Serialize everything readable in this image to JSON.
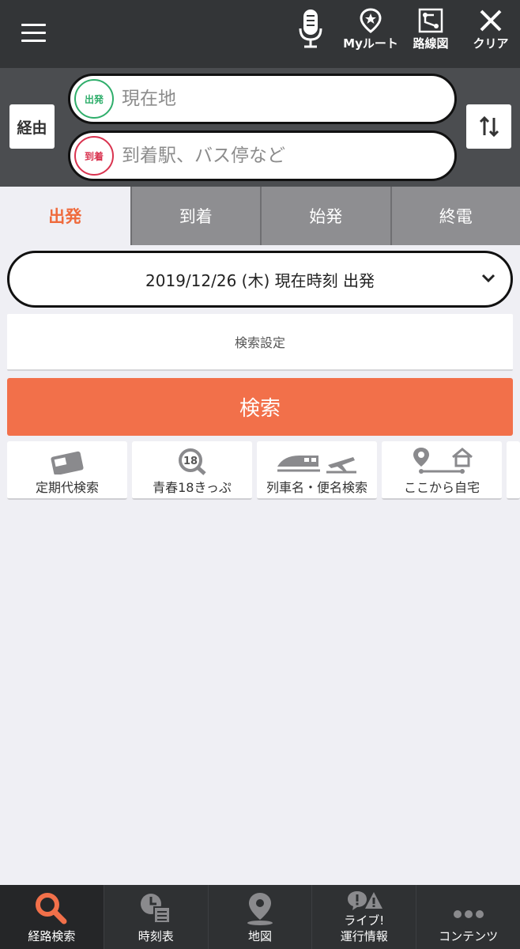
{
  "header": {
    "mic_label": "",
    "my_route_label": "Myルート",
    "route_map_label": "路線図",
    "clear_label": "クリア"
  },
  "search": {
    "via_label": "経由",
    "from_badge": "出発",
    "from_placeholder": "現在地",
    "to_badge": "到着",
    "to_placeholder": "到着駅、バス停など"
  },
  "tabs": [
    {
      "label": "出発",
      "active": true
    },
    {
      "label": "到着",
      "active": false
    },
    {
      "label": "始発",
      "active": false
    },
    {
      "label": "終電",
      "active": false
    }
  ],
  "date_selector": {
    "value": "2019/12/26 (木) 現在時刻 出発"
  },
  "settings_label": "検索設定",
  "search_button_label": "検索",
  "shortcuts": [
    {
      "label": "定期代検索",
      "icon": "commuter-pass-icon"
    },
    {
      "label": "青春18きっぷ",
      "icon": "seishun18-icon"
    },
    {
      "label": "列車名・便名検索",
      "icon": "train-plane-icon"
    },
    {
      "label": "ここから自宅",
      "icon": "route-home-icon"
    }
  ],
  "bottom_nav": [
    {
      "label": "経路検索",
      "icon": "search-icon",
      "active": true
    },
    {
      "label": "時刻表",
      "icon": "timetable-icon"
    },
    {
      "label": "地図",
      "icon": "map-pin-icon"
    },
    {
      "label": "運行情報",
      "label_top": "ライブ!",
      "icon": "alert-icon"
    },
    {
      "label": "コンテンツ",
      "icon": "more-icon"
    }
  ],
  "colors": {
    "accent": "#f2704a",
    "topbar": "#333537",
    "search_area": "#4b4d50",
    "from_green": "#2fae6b",
    "to_red": "#d9334f"
  }
}
